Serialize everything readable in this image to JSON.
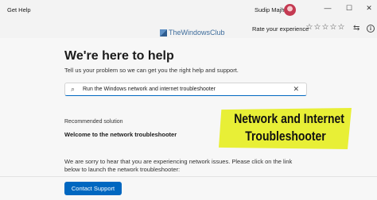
{
  "window": {
    "title": "Get Help",
    "user_name": "Sudip Majhi",
    "minimize_glyph": "—",
    "maximize_glyph": "☐",
    "close_glyph": "✕"
  },
  "toolbar": {
    "rate_label": "Rate your experience",
    "star_glyph": "☆",
    "stars": 5,
    "rating_value": 0,
    "share_glyph": "⇆",
    "info_glyph": "i"
  },
  "watermark": {
    "text": "TheWindowsClub"
  },
  "main": {
    "heading": "We're here to help",
    "subheading": "Tell us your problem so we can get you the right help and support.",
    "search": {
      "value": "Run the Windows network and internet troubleshooter",
      "search_glyph": "⌕",
      "clear_glyph": "✕"
    },
    "recommended_label": "Recommended solution",
    "welcome_text": "Welcome to the network troubleshooter",
    "description": "We are sorry to hear that you are experiencing network issues. Please click on the link below to launch the network troubleshooter:"
  },
  "footer": {
    "contact_button": "Contact Support"
  },
  "overlay": {
    "line1": "Network and Internet",
    "line2": "Troubleshooter",
    "background": "#e8ef36"
  },
  "colors": {
    "accent": "#0067c0",
    "background": "#f3f3f3"
  }
}
